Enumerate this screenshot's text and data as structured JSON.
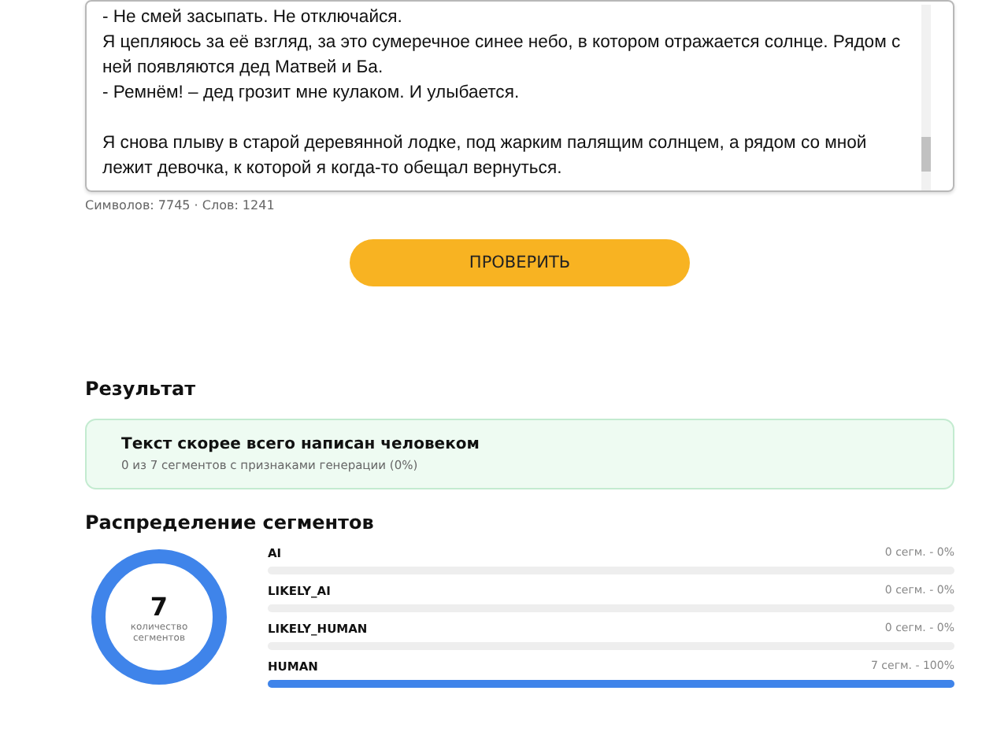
{
  "editor": {
    "paragraphs": [
      {
        "lines": [
          "- Не смей засыпать. Не отключайся.",
          "Я цепляюсь за её взгляд, за это сумеречное синее небо, в котором отражается солнце. Рядом с ней появляются дед Матвей и Ба.",
          "- Ремнём! – дед грозит мне кулаком. И улыбается."
        ]
      },
      {
        "lines": [
          "Я снова плыву в старой деревянной лодке, под жарким палящим солнцем, а рядом со мной лежит девочка, к которой я когда-то обещал вернуться."
        ]
      }
    ],
    "counter": "Символов: 7745 · Слов: 1241"
  },
  "check_button": "ПРОВЕРИТЬ",
  "result": {
    "heading": "Результат",
    "verdict": "Текст скорее всего написан человеком",
    "detail": "0 из 7 сегментов с признаками генерации (0%)"
  },
  "distribution": {
    "heading": "Распределение сегментов",
    "total": "7",
    "total_label": "количество сегментов",
    "segments": [
      {
        "label": "AI",
        "reading": "0 сегм. - 0%",
        "level": 0
      },
      {
        "label": "LIKELY_AI",
        "reading": "0 сегм. - 0%",
        "level": 0
      },
      {
        "label": "LIKELY_HUMAN",
        "reading": "0 сегм. - 0%",
        "level": 0
      },
      {
        "label": "HUMAN",
        "reading": "7 сегм. - 100%",
        "level": 1
      }
    ]
  }
}
